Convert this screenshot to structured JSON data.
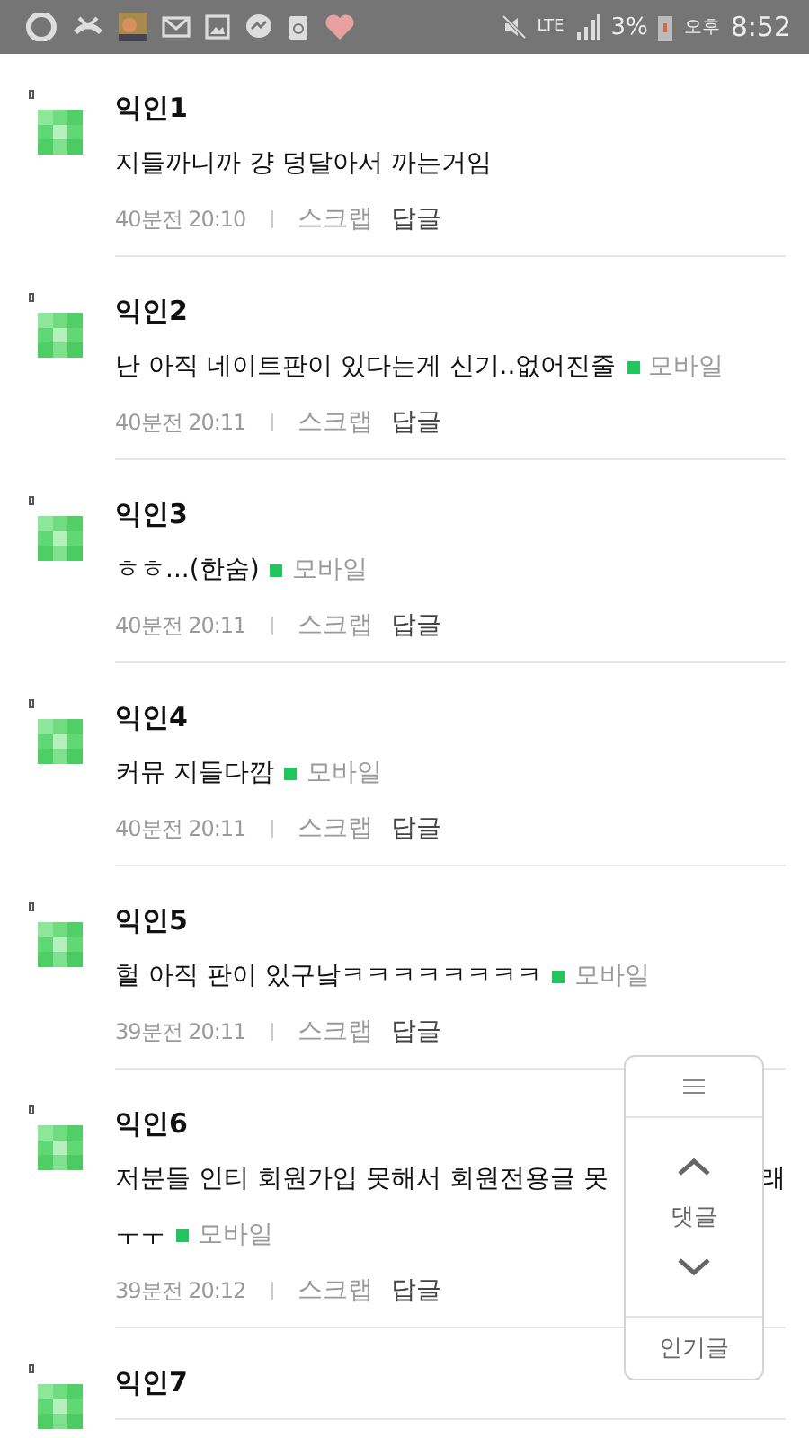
{
  "status_bar": {
    "network": "LTE",
    "battery": "3%",
    "ampm": "오후",
    "time": "8:52"
  },
  "comments": [
    {
      "author": "익인1",
      "lines": [
        [
          "지들까니까 걍 덩달아서 까는거임"
        ]
      ],
      "time": "40분전 20:10",
      "actions": [
        "스크랩",
        "답글"
      ]
    },
    {
      "author": "익인2",
      "lines": [
        [
          "난 아직 네이트판이 있다는게 신기..없어진줄"
        ]
      ],
      "tag": "모바일",
      "time": "40분전 20:11",
      "actions": [
        "스크랩",
        "답글"
      ]
    },
    {
      "author": "익인3",
      "lines": [
        [
          "ㅎㅎ...(한숨)"
        ]
      ],
      "tag": "모바일",
      "time": "40분전 20:11",
      "actions": [
        "스크랩",
        "답글"
      ]
    },
    {
      "author": "익인4",
      "lines": [
        [
          "커뮤 지들다깜"
        ]
      ],
      "tag": "모바일",
      "time": "40분전 20:11",
      "actions": [
        "스크랩",
        "답글"
      ]
    },
    {
      "author": "익인5",
      "lines": [
        [
          "헐 아직 판이 있구낰ㅋㅋㅋㅋㅋㅋㅋㅋ"
        ]
      ],
      "tag": "모바일",
      "time": "39분전 20:11",
      "actions": [
        "스크랩",
        "답글"
      ]
    },
    {
      "author": "익인6",
      "lines": [
        [
          "저분들 인티 회원가입 못해서 회원전용글 못",
          "래"
        ],
        [
          "ㅜㅜ"
        ]
      ],
      "tag": "모바일",
      "time": "39분전 20:12",
      "actions": [
        "스크랩",
        "답글"
      ]
    },
    {
      "author": "익인7"
    }
  ],
  "float_panel": {
    "label": "댓글",
    "popular": "인기글"
  }
}
